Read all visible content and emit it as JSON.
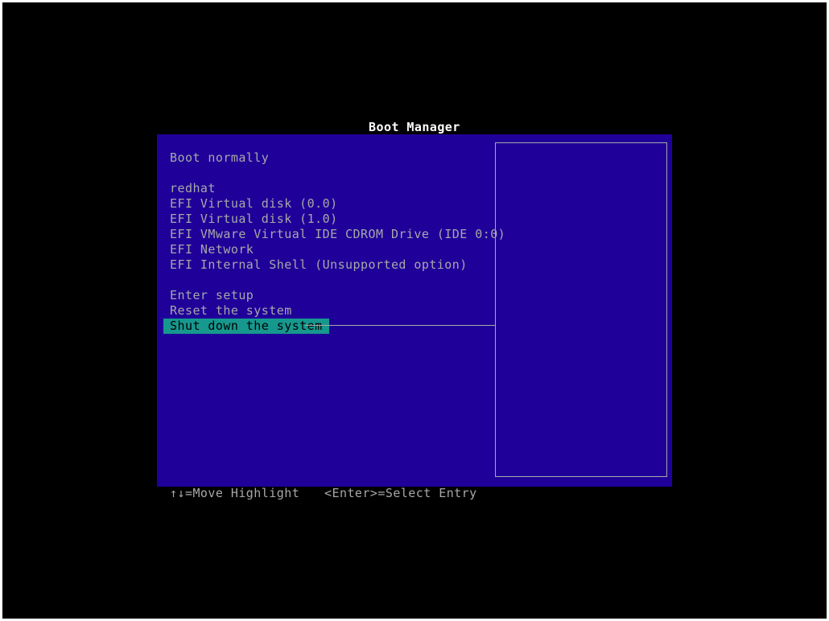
{
  "title": "Boot Manager",
  "menu": {
    "default_group": [
      {
        "label": "Boot normally"
      }
    ],
    "boot_options": [
      {
        "label": "redhat"
      },
      {
        "label": "EFI Virtual disk (0.0)"
      },
      {
        "label": "EFI Virtual disk (1.0)"
      },
      {
        "label": "EFI VMware Virtual IDE CDROM Drive (IDE 0:0)"
      },
      {
        "label": "EFI Network"
      },
      {
        "label": "EFI Internal Shell (Unsupported option)"
      }
    ],
    "system_actions": [
      {
        "label": "Enter setup"
      },
      {
        "label": "Reset the system"
      },
      {
        "label": "Shut down the system",
        "selected": true
      }
    ]
  },
  "footer": {
    "move_hint": "↑↓=Move Highlight",
    "select_hint": "<Enter>=Select Entry"
  },
  "colors": {
    "screen_background": "#000000",
    "panel_background": "#1f0099",
    "text": "#a8a8a8",
    "title_text": "#ffffff",
    "highlight_background": "#16988e",
    "highlight_text": "#000000"
  }
}
